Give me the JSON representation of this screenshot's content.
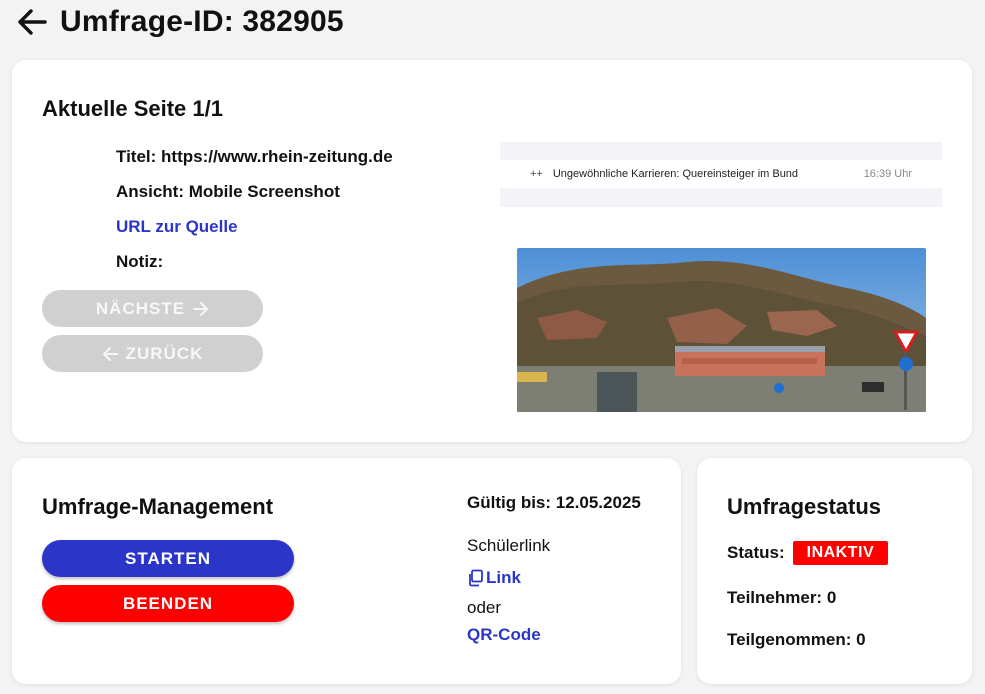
{
  "header": {
    "title": "Umfrage-ID: 382905",
    "back_icon": "arrow-left-icon"
  },
  "page_card": {
    "title": "Aktuelle Seite 1/1",
    "titel_line": "Titel: https://www.rhein-zeitung.de",
    "ansicht_line": "Ansicht: Mobile Screenshot",
    "source_link": "URL zur Quelle",
    "notiz_line": "Notiz:",
    "next_button": "NÄCHSTE",
    "back_button": "ZURÜCK",
    "screenshot": {
      "prefix": "++",
      "headline": "Ungewöhnliche Karrieren: Quereinsteiger im Bund",
      "time": "16:39 Uhr"
    }
  },
  "management": {
    "title": "Umfrage-Management",
    "start_button": "STARTEN",
    "end_button": "BEENDEN",
    "valid_until": "Gültig bis: 12.05.2025",
    "student_link_label": "Schülerlink",
    "link_label": "Link",
    "or_label": "oder",
    "qr_label": "QR-Code",
    "copy_icon": "copy-icon"
  },
  "status": {
    "title": "Umfragestatus",
    "status_label": "Status:",
    "status_value": "INAKTIV",
    "participants_line": "Teilnehmer: 0",
    "completed_line": "Teilgenommen: 0"
  },
  "colors": {
    "accent": "#2b36c8",
    "danger": "#ff0000",
    "disabled": "#d0d0d0",
    "background": "#f3f3f3"
  }
}
